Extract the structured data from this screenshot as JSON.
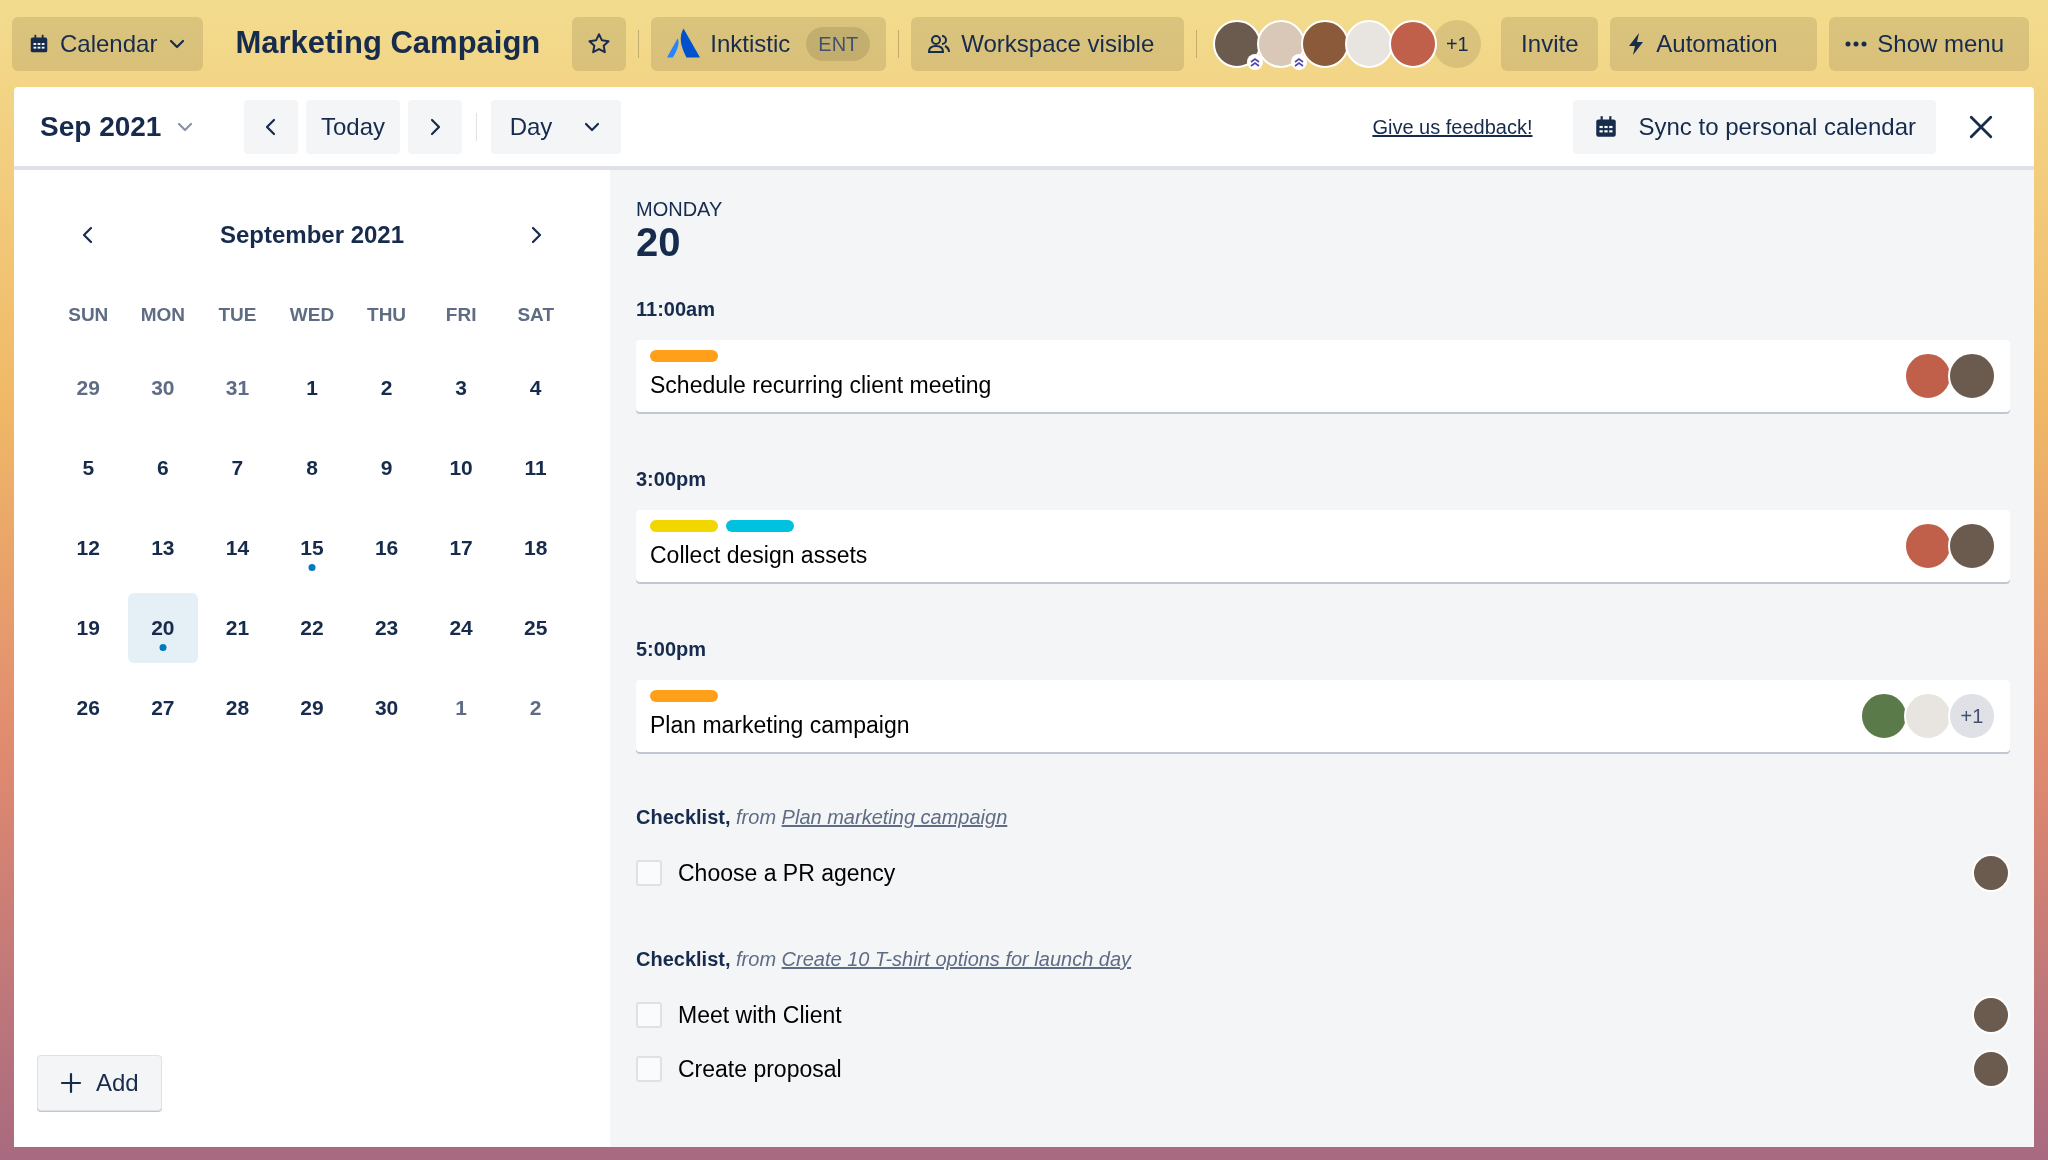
{
  "topbar": {
    "view_switcher": "Calendar",
    "board_title": "Marketing Campaign",
    "workspace": {
      "name": "Inktistic",
      "badge": "ENT"
    },
    "visibility": "Workspace visible",
    "members": [
      {
        "color": "#6b5a4e",
        "admin": true
      },
      {
        "color": "#d9c7b8",
        "admin": true
      },
      {
        "color": "#8a5a3a",
        "admin": false
      },
      {
        "color": "#e8e4e0",
        "admin": false
      },
      {
        "color": "#c0604a",
        "admin": false
      }
    ],
    "members_more": "+1",
    "invite": "Invite",
    "automation": "Automation",
    "show_menu": "Show menu"
  },
  "toolbar": {
    "month": "Sep 2021",
    "today": "Today",
    "view": "Day",
    "feedback": "Give us feedback!",
    "sync": "Sync to personal calendar"
  },
  "mini_calendar": {
    "title": "September 2021",
    "weekdays": [
      "SUN",
      "MON",
      "TUE",
      "WED",
      "THU",
      "FRI",
      "SAT"
    ],
    "weeks": [
      [
        {
          "label": "29",
          "muted": true,
          "selected": false,
          "has_event": false
        },
        {
          "label": "30",
          "muted": true,
          "selected": false,
          "has_event": false
        },
        {
          "label": "31",
          "muted": true,
          "selected": false,
          "has_event": false
        },
        {
          "label": "1",
          "muted": false,
          "selected": false,
          "has_event": false
        },
        {
          "label": "2",
          "muted": false,
          "selected": false,
          "has_event": false
        },
        {
          "label": "3",
          "muted": false,
          "selected": false,
          "has_event": false
        },
        {
          "label": "4",
          "muted": false,
          "selected": false,
          "has_event": false
        }
      ],
      [
        {
          "label": "5",
          "muted": false,
          "selected": false,
          "has_event": false
        },
        {
          "label": "6",
          "muted": false,
          "selected": false,
          "has_event": false
        },
        {
          "label": "7",
          "muted": false,
          "selected": false,
          "has_event": false
        },
        {
          "label": "8",
          "muted": false,
          "selected": false,
          "has_event": false
        },
        {
          "label": "9",
          "muted": false,
          "selected": false,
          "has_event": false
        },
        {
          "label": "10",
          "muted": false,
          "selected": false,
          "has_event": false
        },
        {
          "label": "11",
          "muted": false,
          "selected": false,
          "has_event": false
        }
      ],
      [
        {
          "label": "12",
          "muted": false,
          "selected": false,
          "has_event": false
        },
        {
          "label": "13",
          "muted": false,
          "selected": false,
          "has_event": false
        },
        {
          "label": "14",
          "muted": false,
          "selected": false,
          "has_event": false
        },
        {
          "label": "15",
          "muted": false,
          "selected": false,
          "has_event": true
        },
        {
          "label": "16",
          "muted": false,
          "selected": false,
          "has_event": false
        },
        {
          "label": "17",
          "muted": false,
          "selected": false,
          "has_event": false
        },
        {
          "label": "18",
          "muted": false,
          "selected": false,
          "has_event": false
        }
      ],
      [
        {
          "label": "19",
          "muted": false,
          "selected": false,
          "has_event": false
        },
        {
          "label": "20",
          "muted": false,
          "selected": true,
          "has_event": true
        },
        {
          "label": "21",
          "muted": false,
          "selected": false,
          "has_event": false
        },
        {
          "label": "22",
          "muted": false,
          "selected": false,
          "has_event": false
        },
        {
          "label": "23",
          "muted": false,
          "selected": false,
          "has_event": false
        },
        {
          "label": "24",
          "muted": false,
          "selected": false,
          "has_event": false
        },
        {
          "label": "25",
          "muted": false,
          "selected": false,
          "has_event": false
        }
      ],
      [
        {
          "label": "26",
          "muted": false,
          "selected": false,
          "has_event": false
        },
        {
          "label": "27",
          "muted": false,
          "selected": false,
          "has_event": false
        },
        {
          "label": "28",
          "muted": false,
          "selected": false,
          "has_event": false
        },
        {
          "label": "29",
          "muted": false,
          "selected": false,
          "has_event": false
        },
        {
          "label": "30",
          "muted": false,
          "selected": false,
          "has_event": false
        },
        {
          "label": "1",
          "muted": true,
          "selected": false,
          "has_event": false
        },
        {
          "label": "2",
          "muted": true,
          "selected": false,
          "has_event": false
        }
      ]
    ]
  },
  "add_button": "Add",
  "day": {
    "weekday": "MONDAY",
    "date": "20",
    "slots": [
      {
        "time": "11:00am",
        "card": {
          "labels": [
            {
              "color": "#ff9f1a"
            }
          ],
          "title": "Schedule recurring client meeting",
          "avatars": [
            {
              "color": "#c0604a"
            },
            {
              "color": "#6b5a4e"
            }
          ]
        }
      },
      {
        "time": "3:00pm",
        "card": {
          "labels": [
            {
              "color": "#f2d600"
            },
            {
              "color": "#00c2e0"
            }
          ],
          "title": "Collect design assets",
          "avatars": [
            {
              "color": "#c0604a"
            },
            {
              "color": "#6b5a4e"
            }
          ]
        }
      },
      {
        "time": "5:00pm",
        "card": {
          "labels": [
            {
              "color": "#ff9f1a"
            }
          ],
          "title": "Plan marketing campaign",
          "avatars": [
            {
              "color": "#5a7a4a"
            },
            {
              "color": "#e8e4e0"
            }
          ],
          "more": "+1"
        }
      }
    ],
    "checklists": [
      {
        "heading": "Checklist,",
        "from": "from",
        "card": "Plan marketing campaign",
        "items": [
          {
            "text": "Choose a PR agency",
            "checked": false,
            "avatar": {
              "color": "#6b5a4e"
            }
          }
        ]
      },
      {
        "heading": "Checklist,",
        "from": "from",
        "card": "Create 10 T-shirt options for launch day",
        "items": [
          {
            "text": "Meet with Client",
            "checked": false,
            "avatar": {
              "color": "#6b5a4e"
            }
          },
          {
            "text": "Create proposal",
            "checked": false,
            "avatar": {
              "color": "#6b5a4e"
            }
          }
        ]
      }
    ]
  }
}
